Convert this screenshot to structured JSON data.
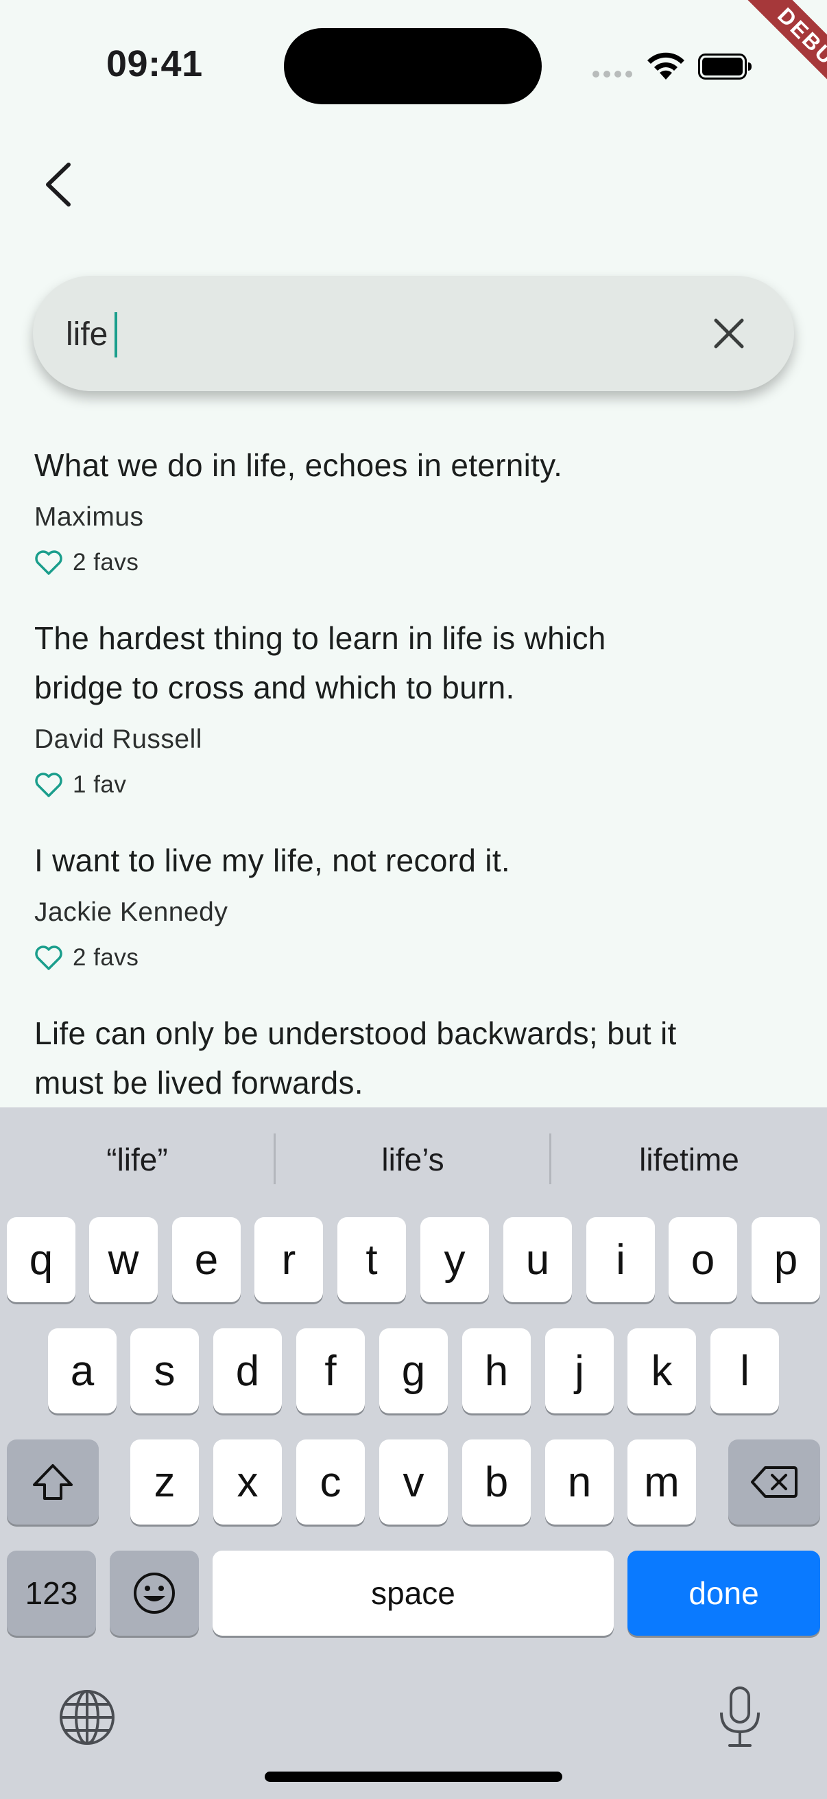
{
  "status": {
    "time": "09:41",
    "debug_label": "DEBUG"
  },
  "nav": {
    "back_icon": "chevron-left-icon"
  },
  "search": {
    "value": "life",
    "placeholder": "",
    "clear_icon": "close-icon"
  },
  "results": [
    {
      "text_lines": [
        "What we do in life, echoes in eternity."
      ],
      "author": "Maximus",
      "favs": "2 favs"
    },
    {
      "text_lines": [
        "The hardest thing to learn in life is which",
        "bridge to cross and which to burn."
      ],
      "author": "David Russell",
      "favs": "1 fav"
    },
    {
      "text_lines": [
        "I want to live my life, not record it."
      ],
      "author": "Jackie Kennedy",
      "favs": "2 favs"
    },
    {
      "text_lines": [
        "Life can only be understood backwards; but it",
        "must be lived forwards."
      ]
    }
  ],
  "keyboard": {
    "suggestions": [
      "“life”",
      "life’s",
      "lifetime"
    ],
    "row1": [
      "q",
      "w",
      "e",
      "r",
      "t",
      "y",
      "u",
      "i",
      "o",
      "p"
    ],
    "row2": [
      "a",
      "s",
      "d",
      "f",
      "g",
      "h",
      "j",
      "k",
      "l"
    ],
    "row3": [
      "z",
      "x",
      "c",
      "v",
      "b",
      "n",
      "m"
    ],
    "num_label": "123",
    "space_label": "space",
    "done_label": "done"
  },
  "colors": {
    "accent": "#1a9e8c",
    "background": "#f3f9f6",
    "done_key": "#0a7aff",
    "debug_banner": "#a6383a"
  }
}
